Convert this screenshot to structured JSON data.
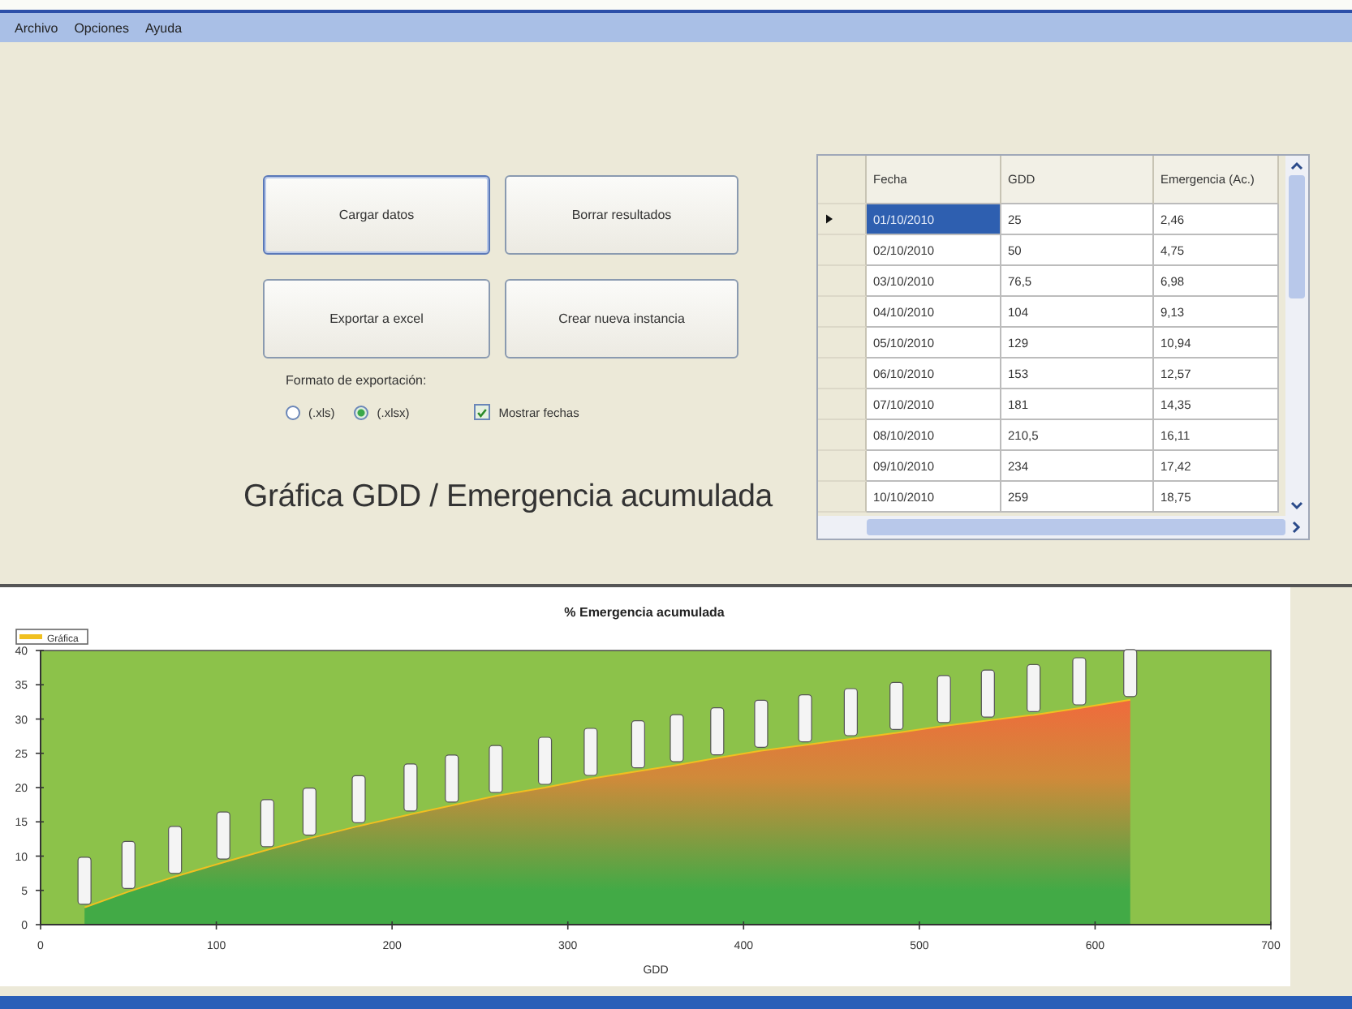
{
  "menu": [
    {
      "label": "Archivo"
    },
    {
      "label": "Opciones"
    },
    {
      "label": "Ayuda"
    }
  ],
  "buttons": [
    {
      "label": "Cargar datos",
      "focused": true
    },
    {
      "label": "Borrar resultados",
      "focused": false
    },
    {
      "label": "Exportar a excel",
      "focused": false
    },
    {
      "label": "Crear nueva instancia",
      "focused": false
    }
  ],
  "export_format": {
    "label": "Formato de exportación:",
    "options": [
      {
        "label": "(.xls)",
        "selected": false
      },
      {
        "label": "(.xlsx)",
        "selected": true
      }
    ]
  },
  "show_dates": {
    "label": "Mostrar fechas",
    "checked": true
  },
  "heading": "Gráfica GDD / Emergencia acumulada",
  "grid": {
    "columns": [
      "Fecha",
      "GDD",
      "Emergencia (Ac.)"
    ],
    "rows": [
      {
        "cells": [
          "01/10/2010",
          "25",
          "2,46"
        ],
        "selected": true
      },
      {
        "cells": [
          "02/10/2010",
          "50",
          "4,75"
        ],
        "selected": false
      },
      {
        "cells": [
          "03/10/2010",
          "76,5",
          "6,98"
        ],
        "selected": false
      },
      {
        "cells": [
          "04/10/2010",
          "104",
          "9,13"
        ],
        "selected": false
      },
      {
        "cells": [
          "05/10/2010",
          "129",
          "10,94"
        ],
        "selected": false
      },
      {
        "cells": [
          "06/10/2010",
          "153",
          "12,57"
        ],
        "selected": false
      },
      {
        "cells": [
          "07/10/2010",
          "181",
          "14,35"
        ],
        "selected": false
      },
      {
        "cells": [
          "08/10/2010",
          "210,5",
          "16,11"
        ],
        "selected": false
      },
      {
        "cells": [
          "09/10/2010",
          "234",
          "17,42"
        ],
        "selected": false
      },
      {
        "cells": [
          "10/10/2010",
          "259",
          "18,75"
        ],
        "selected": false
      }
    ]
  },
  "chart": {
    "chart_data": {
      "type": "area",
      "title": "% Emergencia acumulada",
      "xlabel": "GDD",
      "x": [
        25,
        50,
        76.5,
        104,
        129,
        153,
        181,
        210.5,
        234,
        259,
        287,
        313,
        340,
        362,
        385,
        410,
        435,
        461,
        487,
        514,
        539,
        565,
        591,
        620
      ],
      "series": [
        {
          "name": "Gráfica",
          "color": "#f0c020",
          "values": [
            2.5,
            4.8,
            7,
            9.1,
            10.9,
            12.6,
            14.4,
            16.1,
            17.4,
            18.8,
            20,
            21.3,
            22.4,
            23.3,
            24.3,
            25.4,
            26.2,
            27.1,
            28,
            29,
            29.8,
            30.6,
            31.6,
            32.8
          ]
        }
      ],
      "xlim": [
        0,
        700
      ],
      "ylim": [
        0,
        40
      ],
      "xticks": [
        0,
        100,
        200,
        300,
        400,
        500,
        600,
        700
      ],
      "yticks": [
        0,
        5,
        10,
        15,
        20,
        25,
        30,
        35,
        40
      ]
    }
  }
}
